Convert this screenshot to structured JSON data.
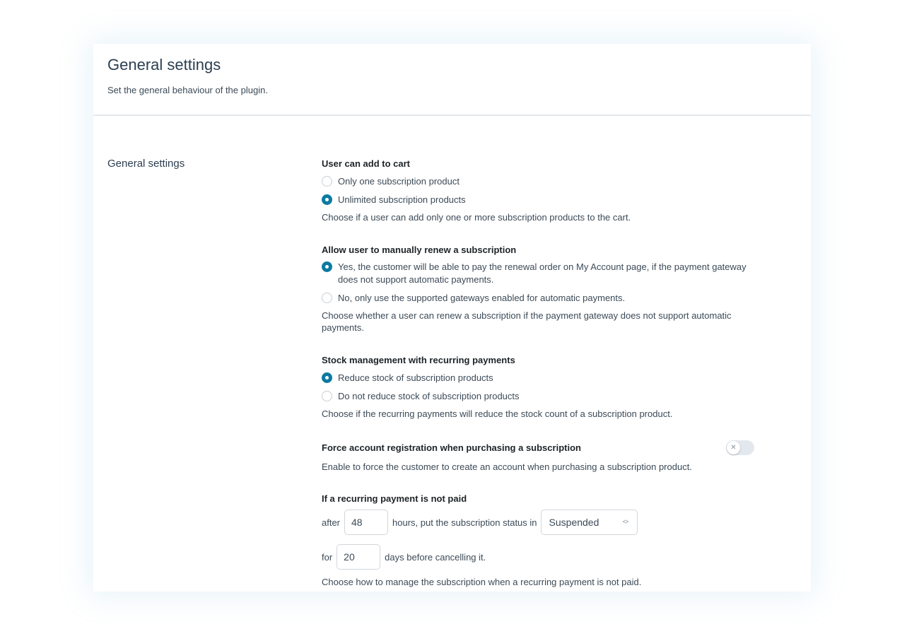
{
  "header": {
    "title": "General settings",
    "subtitle": "Set the general behaviour of the plugin."
  },
  "section": {
    "title": "General settings"
  },
  "fields": {
    "add_to_cart": {
      "label": "User can add to cart",
      "options": [
        {
          "label": "Only one subscription product",
          "selected": false
        },
        {
          "label": "Unlimited subscription products",
          "selected": true
        }
      ],
      "description": "Choose if a user can add only one or more subscription products to the cart."
    },
    "manual_renew": {
      "label": "Allow user to manually renew a subscription",
      "options": [
        {
          "label": "Yes, the customer will be able to pay the renewal order on My Account page, if the payment gateway does not support automatic payments.",
          "selected": true
        },
        {
          "label": "No, only use the supported gateways enabled for automatic payments.",
          "selected": false
        }
      ],
      "description": "Choose whether a user can renew a subscription if the payment gateway does not support automatic payments."
    },
    "stock": {
      "label": "Stock management with recurring payments",
      "options": [
        {
          "label": "Reduce stock of subscription products",
          "selected": true
        },
        {
          "label": "Do not reduce stock of subscription products",
          "selected": false
        }
      ],
      "description": "Choose if the recurring payments will reduce the stock count of a subscription product."
    },
    "force_registration": {
      "label": "Force account registration when purchasing a subscription",
      "enabled": false,
      "toggle_icon": "close-icon",
      "description": "Enable to force the customer to create an account when purchasing a subscription product."
    },
    "not_paid": {
      "label": "If a recurring payment is not paid",
      "after_text": "after",
      "hours_value": "48",
      "hours_text": "hours, put the subscription status in",
      "status_value": "Suspended",
      "for_text": "for",
      "days_value": "20",
      "days_text": "days before cancelling it.",
      "description": "Choose how to manage the subscription when a recurring payment is not paid."
    }
  },
  "colors": {
    "accent": "#0d7ba1",
    "panel_shadow": "#d9eef6"
  }
}
